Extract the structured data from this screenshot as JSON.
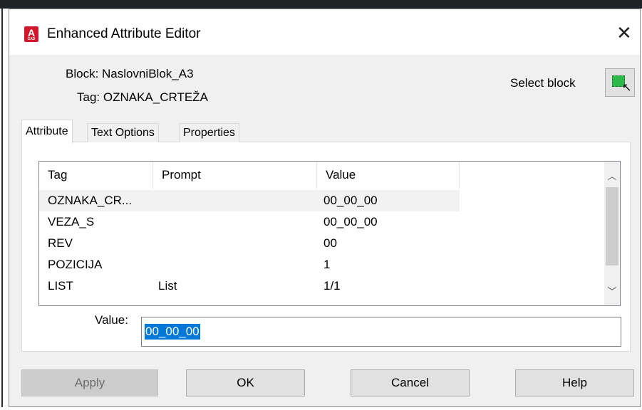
{
  "window": {
    "title": "Enhanced Attribute Editor",
    "icon_text": "A",
    "icon_subtext": "CAD"
  },
  "info": {
    "block_label": "Block: NaslovniBlok_A3",
    "tag_label": "Tag: OZNAKA_CRTEŽA"
  },
  "select_block": {
    "label": "Select block"
  },
  "tabs": [
    {
      "label": "Attribute",
      "active": true
    },
    {
      "label": "Text Options",
      "active": false
    },
    {
      "label": "Properties",
      "active": false
    }
  ],
  "table": {
    "columns": [
      "Tag",
      "Prompt",
      "Value"
    ],
    "rows": [
      {
        "tag": "OZNAKA_CR...",
        "prompt": "",
        "value": "00_00_00",
        "selected": true
      },
      {
        "tag": "VEZA_S",
        "prompt": "",
        "value": "00_00_00",
        "selected": false
      },
      {
        "tag": "REV",
        "prompt": "",
        "value": "00",
        "selected": false
      },
      {
        "tag": "POZICIJA",
        "prompt": "",
        "value": "1",
        "selected": false
      },
      {
        "tag": "LIST",
        "prompt": "List",
        "value": "1/1",
        "selected": false
      }
    ]
  },
  "value_field": {
    "label": "Value:",
    "value": "00_00_00"
  },
  "buttons": {
    "apply": "Apply",
    "ok": "OK",
    "cancel": "Cancel",
    "help": "Help"
  },
  "colors": {
    "selection": "#0078d7",
    "app_icon": "#d0192d",
    "select_icon": "#2fb84a"
  }
}
